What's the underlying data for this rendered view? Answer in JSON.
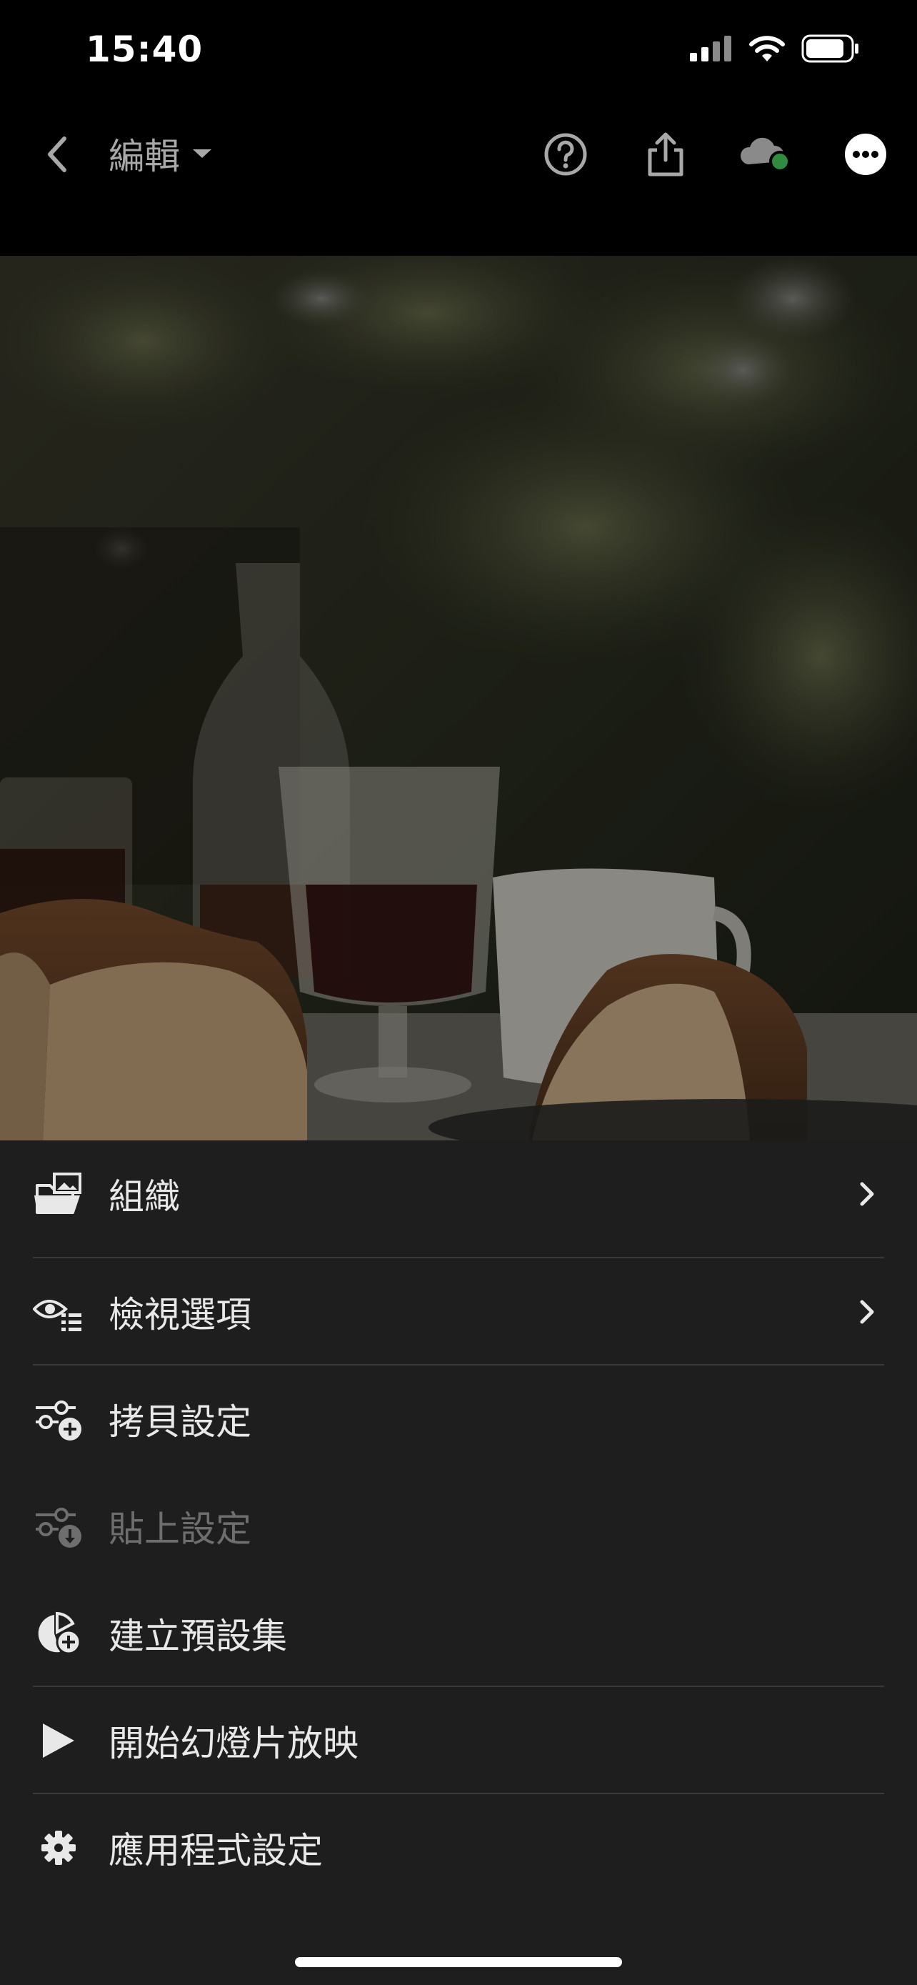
{
  "status_bar": {
    "time": "15:40"
  },
  "toolbar": {
    "title": "編輯",
    "icons": [
      "chevron-left-icon",
      "help-icon",
      "share-icon",
      "cloud-sync-icon",
      "more-icon"
    ],
    "sync_status_color": "#2e8b3f"
  },
  "photo": {
    "description_icon": "photo-canvas"
  },
  "menu": {
    "items": [
      {
        "label": "組織",
        "icon": "folder-image-icon",
        "has_chevron": true,
        "enabled": true
      },
      {
        "label": "檢視選項",
        "icon": "eye-list-icon",
        "has_chevron": true,
        "enabled": true
      },
      {
        "label": "拷貝設定",
        "icon": "sliders-plus-icon",
        "has_chevron": false,
        "enabled": true
      },
      {
        "label": "貼上設定",
        "icon": "sliders-paste-icon",
        "has_chevron": false,
        "enabled": false
      },
      {
        "label": "建立預設集",
        "icon": "preset-plus-icon",
        "has_chevron": false,
        "enabled": true
      },
      {
        "label": "開始幻燈片放映",
        "icon": "play-icon",
        "has_chevron": false,
        "enabled": true
      },
      {
        "label": "應用程式設定",
        "icon": "gear-icon",
        "has_chevron": false,
        "enabled": true
      }
    ]
  },
  "colors": {
    "menu_bg": "#1e1e1e",
    "toolbar_bg": "#000000",
    "text": "#e8e8e8",
    "disabled_text": "#6e6e6e"
  }
}
